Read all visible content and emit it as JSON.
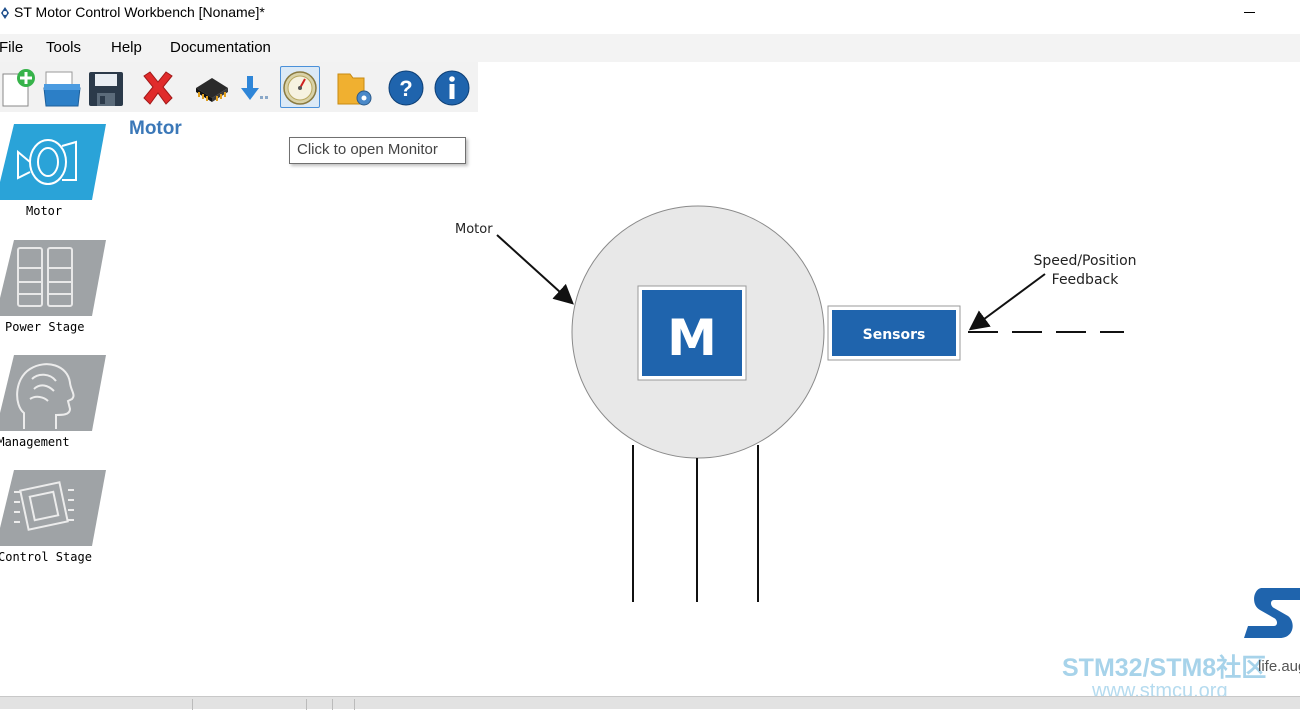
{
  "window": {
    "title": "ST Motor Control Workbench [Noname]*"
  },
  "menu": {
    "items": [
      "File",
      "Tools",
      "Help",
      "Documentation"
    ]
  },
  "toolbar": {
    "buttons": [
      {
        "icon": "new-project-icon"
      },
      {
        "icon": "open-project-icon"
      },
      {
        "icon": "save-icon"
      },
      {
        "icon": "close-project-icon"
      },
      {
        "icon": "generate-code-icon"
      },
      {
        "icon": "download-icon"
      },
      {
        "icon": "monitor-gauge-icon",
        "active": true
      },
      {
        "icon": "folder-settings-icon"
      },
      {
        "icon": "help-icon"
      },
      {
        "icon": "info-icon"
      }
    ],
    "tooltip": "Click to open Monitor"
  },
  "sidebar": {
    "items": [
      {
        "label": "Motor",
        "icon": "motor-icon",
        "active": true
      },
      {
        "label": "Power Stage",
        "icon": "power-stage-icon"
      },
      {
        "label": "Drive Management",
        "icon": "drive-management-icon"
      },
      {
        "label": "Control Stage",
        "icon": "control-stage-icon"
      }
    ]
  },
  "main": {
    "section_title": "Motor"
  },
  "diagram": {
    "motor_label": "Motor",
    "motor_block_text": "M",
    "sensors_label": "Sensors",
    "feedback_label_line1": "Speed/Position",
    "feedback_label_line2": "Feedback"
  },
  "colors": {
    "accent_blue": "#1f64ad",
    "title_blue": "#3b78b8",
    "tile_active": "#2aa3d8",
    "tile_inactive": "#9fa3a6",
    "motor_circle": "#e8e8e8"
  },
  "watermark": {
    "line1": "STM32/STM8社区",
    "line2": "www.stmcu.org",
    "overlap_text": "life.aug"
  }
}
